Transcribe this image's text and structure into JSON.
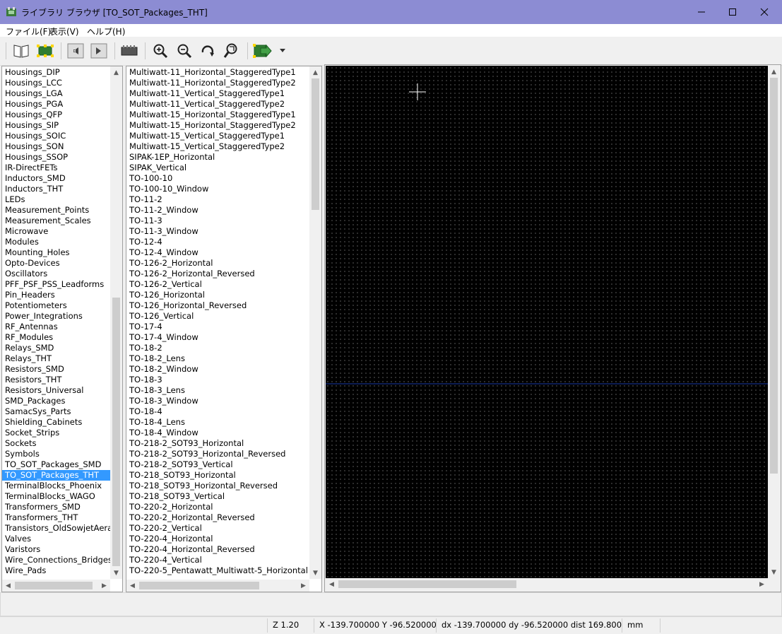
{
  "window": {
    "title": "ライブラリ ブラウザ [TO_SOT_Packages_THT]"
  },
  "menu": [
    "ファイル(F)",
    "表示(V)",
    "ヘルプ(H)"
  ],
  "toolbar": {
    "icons": [
      "library-select-icon",
      "footprint-select-icon",
      "previous-icon",
      "next-icon",
      "view-3d-icon",
      "zoom-in-icon",
      "zoom-out-icon",
      "redraw-icon",
      "zoom-fit-icon",
      "insert-footprint-icon",
      "dropdown-icon"
    ]
  },
  "libraries": {
    "selected": "TO_SOT_Packages_THT",
    "items": [
      "Housings_DIP",
      "Housings_LCC",
      "Housings_LGA",
      "Housings_PGA",
      "Housings_QFP",
      "Housings_SIP",
      "Housings_SOIC",
      "Housings_SON",
      "Housings_SSOP",
      "IR-DirectFETs",
      "Inductors_SMD",
      "Inductors_THT",
      "LEDs",
      "Measurement_Points",
      "Measurement_Scales",
      "Microwave",
      "Modules",
      "Mounting_Holes",
      "Opto-Devices",
      "Oscillators",
      "PFF_PSF_PSS_Leadforms",
      "Pin_Headers",
      "Potentiometers",
      "Power_Integrations",
      "RF_Antennas",
      "RF_Modules",
      "Relays_SMD",
      "Relays_THT",
      "Resistors_SMD",
      "Resistors_THT",
      "Resistors_Universal",
      "SMD_Packages",
      "SamacSys_Parts",
      "Shielding_Cabinets",
      "Socket_Strips",
      "Sockets",
      "Symbols",
      "TO_SOT_Packages_SMD",
      "TO_SOT_Packages_THT",
      "TerminalBlocks_Phoenix",
      "TerminalBlocks_WAGO",
      "Transformers_SMD",
      "Transformers_THT",
      "Transistors_OldSowjetAera",
      "Valves",
      "Varistors",
      "Wire_Connections_Bridges",
      "Wire_Pads"
    ]
  },
  "footprints": {
    "items": [
      "Multiwatt-11_Horizontal_StaggeredType1",
      "Multiwatt-11_Horizontal_StaggeredType2",
      "Multiwatt-11_Vertical_StaggeredType1",
      "Multiwatt-11_Vertical_StaggeredType2",
      "Multiwatt-15_Horizontal_StaggeredType1",
      "Multiwatt-15_Horizontal_StaggeredType2",
      "Multiwatt-15_Vertical_StaggeredType1",
      "Multiwatt-15_Vertical_StaggeredType2",
      "SIPAK-1EP_Horizontal",
      "SIPAK_Vertical",
      "TO-100-10",
      "TO-100-10_Window",
      "TO-11-2",
      "TO-11-2_Window",
      "TO-11-3",
      "TO-11-3_Window",
      "TO-12-4",
      "TO-12-4_Window",
      "TO-126-2_Horizontal",
      "TO-126-2_Horizontal_Reversed",
      "TO-126-2_Vertical",
      "TO-126_Horizontal",
      "TO-126_Horizontal_Reversed",
      "TO-126_Vertical",
      "TO-17-4",
      "TO-17-4_Window",
      "TO-18-2",
      "TO-18-2_Lens",
      "TO-18-2_Window",
      "TO-18-3",
      "TO-18-3_Lens",
      "TO-18-3_Window",
      "TO-18-4",
      "TO-18-4_Lens",
      "TO-18-4_Window",
      "TO-218-2_SOT93_Horizontal",
      "TO-218-2_SOT93_Horizontal_Reversed",
      "TO-218-2_SOT93_Vertical",
      "TO-218_SOT93_Horizontal",
      "TO-218_SOT93_Horizontal_Reversed",
      "TO-218_SOT93_Vertical",
      "TO-220-2_Horizontal",
      "TO-220-2_Horizontal_Reversed",
      "TO-220-2_Vertical",
      "TO-220-4_Horizontal",
      "TO-220-4_Horizontal_Reversed",
      "TO-220-4_Vertical",
      "TO-220-5_Pentawatt_Multiwatt-5_Horizontal"
    ]
  },
  "status": {
    "zoom": "Z 1.20",
    "xy": "X -139.700000  Y -96.520000",
    "delta": "dx -139.700000  dy -96.520000  dist 169.800",
    "units": "mm"
  },
  "colors": {
    "titlebar": "#8c8cd3",
    "selection": "#3399ff",
    "canvas": "#000000",
    "axis_line": "#1a3aa8"
  }
}
